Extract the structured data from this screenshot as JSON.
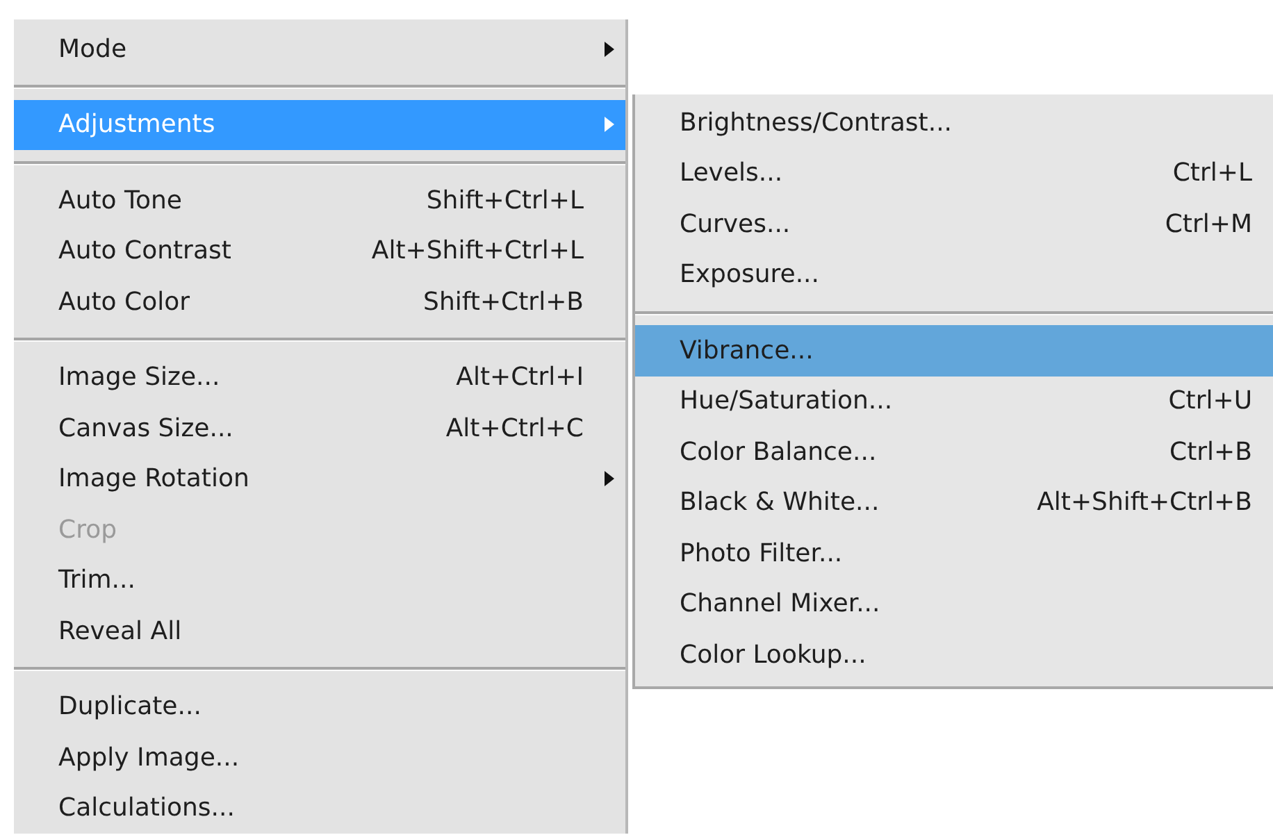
{
  "main_menu": {
    "items": [
      {
        "kind": "item",
        "label": "Mode",
        "submenu": true,
        "disabled": false,
        "selected": false
      },
      {
        "kind": "separator"
      },
      {
        "kind": "item",
        "label": "Adjustments",
        "submenu": true,
        "disabled": false,
        "selected": true
      },
      {
        "kind": "separator"
      },
      {
        "kind": "item",
        "label": "Auto Tone",
        "shortcut": "Shift+Ctrl+L",
        "submenu": false,
        "disabled": false,
        "selected": false
      },
      {
        "kind": "item",
        "label": "Auto Contrast",
        "shortcut": "Alt+Shift+Ctrl+L",
        "submenu": false,
        "disabled": false,
        "selected": false
      },
      {
        "kind": "item",
        "label": "Auto Color",
        "shortcut": "Shift+Ctrl+B",
        "submenu": false,
        "disabled": false,
        "selected": false
      },
      {
        "kind": "separator"
      },
      {
        "kind": "item",
        "label": "Image Size...",
        "shortcut": "Alt+Ctrl+I",
        "submenu": false,
        "disabled": false,
        "selected": false
      },
      {
        "kind": "item",
        "label": "Canvas Size...",
        "shortcut": "Alt+Ctrl+C",
        "submenu": false,
        "disabled": false,
        "selected": false
      },
      {
        "kind": "item",
        "label": "Image Rotation",
        "submenu": true,
        "disabled": false,
        "selected": false
      },
      {
        "kind": "item",
        "label": "Crop",
        "submenu": false,
        "disabled": true,
        "selected": false
      },
      {
        "kind": "item",
        "label": "Trim...",
        "submenu": false,
        "disabled": false,
        "selected": false
      },
      {
        "kind": "item",
        "label": "Reveal All",
        "submenu": false,
        "disabled": false,
        "selected": false
      },
      {
        "kind": "separator"
      },
      {
        "kind": "item",
        "label": "Duplicate...",
        "submenu": false,
        "disabled": false,
        "selected": false
      },
      {
        "kind": "item",
        "label": "Apply Image...",
        "submenu": false,
        "disabled": false,
        "selected": false
      },
      {
        "kind": "item",
        "label": "Calculations...",
        "submenu": false,
        "disabled": false,
        "selected": false
      }
    ]
  },
  "submenu": {
    "items": [
      {
        "kind": "item",
        "label": "Brightness/Contrast...",
        "selected": false
      },
      {
        "kind": "item",
        "label": "Levels...",
        "shortcut": "Ctrl+L",
        "selected": false
      },
      {
        "kind": "item",
        "label": "Curves...",
        "shortcut": "Ctrl+M",
        "selected": false
      },
      {
        "kind": "item",
        "label": "Exposure...",
        "selected": false
      },
      {
        "kind": "separator"
      },
      {
        "kind": "item",
        "label": "Vibrance...",
        "selected": true
      },
      {
        "kind": "item",
        "label": "Hue/Saturation...",
        "shortcut": "Ctrl+U",
        "selected": false
      },
      {
        "kind": "item",
        "label": "Color Balance...",
        "shortcut": "Ctrl+B",
        "selected": false
      },
      {
        "kind": "item",
        "label": "Black & White...",
        "shortcut": "Alt+Shift+Ctrl+B",
        "selected": false
      },
      {
        "kind": "item",
        "label": "Photo Filter...",
        "selected": false
      },
      {
        "kind": "item",
        "label": "Channel Mixer...",
        "selected": false
      },
      {
        "kind": "item",
        "label": "Color Lookup...",
        "selected": false
      }
    ]
  }
}
